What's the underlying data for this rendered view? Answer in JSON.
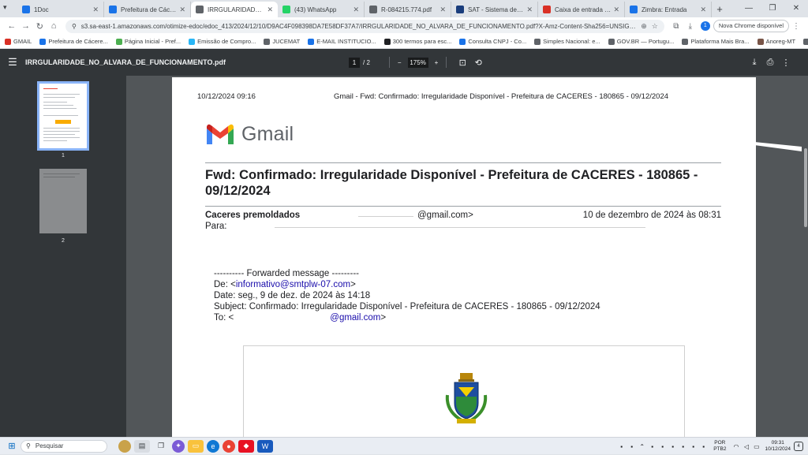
{
  "browser": {
    "tabs": [
      {
        "label": "1Doc",
        "icon": "1doc-icon",
        "color": "#1a73e8"
      },
      {
        "label": "Prefeitura de Cáceres | 1D",
        "icon": "1doc-icon",
        "color": "#1a73e8"
      },
      {
        "label": "IRRGULARIDADE_NO_ALVA",
        "icon": "globe-icon",
        "color": "#5f6368",
        "active": true
      },
      {
        "label": "(43) WhatsApp",
        "icon": "whatsapp-icon",
        "color": "#25d366"
      },
      {
        "label": "R-084215.774.pdf",
        "icon": "globe-icon",
        "color": "#5f6368"
      },
      {
        "label": "SAT - Sistema de Adminis",
        "icon": "sat-icon",
        "color": "#1a3d7c"
      },
      {
        "label": "Caixa de entrada (3) - cto",
        "icon": "gmail-icon",
        "color": "#d93025"
      },
      {
        "label": "Zimbra: Entrada",
        "icon": "zimbra-icon",
        "color": "#1a73e8"
      }
    ],
    "new_tab": "+",
    "url": "s3.sa-east-1.amazonaws.com/otimize-edoc/edoc_413/2024/12/10/D9AC4F098398DA7E58DF37A7/IRRGULARIDADE_NO_ALVARA_DE_FUNCIONAMENTO.pdf?X-Amz-Content-Sha256=UNSIGNED-PAYLOAD&X-Amz-A...",
    "update_button": "Nova Chrome disponível",
    "bookmarks": [
      {
        "label": "GMAIL",
        "color": "#d93025"
      },
      {
        "label": "Prefeitura de Cácere...",
        "color": "#1a73e8"
      },
      {
        "label": "Página Inicial - Pref...",
        "color": "#4caf50"
      },
      {
        "label": "Emissão de Compro...",
        "color": "#29b6f6"
      },
      {
        "label": "JUCEMAT",
        "color": "#5f6368"
      },
      {
        "label": "E-MAIL INSTITUCIO...",
        "color": "#1a73e8"
      },
      {
        "label": "300 termos para esc...",
        "color": "#202124"
      },
      {
        "label": "Consulta CNPJ - Co...",
        "color": "#1a73e8"
      },
      {
        "label": "Simples Nacional: e...",
        "color": "#5f6368"
      },
      {
        "label": "GOV.BR — Portugu...",
        "color": "#5f6368"
      },
      {
        "label": "Plataforma Mais Bra...",
        "color": "#5f6368"
      },
      {
        "label": "Anoreg-MT",
        "color": "#795548"
      },
      {
        "label": "CRC",
        "color": "#5f6368"
      }
    ]
  },
  "pdf_viewer": {
    "title": "IRRGULARIDADE_NO_ALVARA_DE_FUNCIONAMENTO.pdf",
    "current_page": "1",
    "page_sep": "/",
    "total_pages": "2",
    "zoom_minus": "−",
    "zoom": "175%",
    "zoom_plus": "+",
    "thumbnails": [
      {
        "num": "1"
      },
      {
        "num": "2"
      }
    ]
  },
  "document": {
    "print_date": "10/12/2024 09:16",
    "print_title": "Gmail - Fwd: Confirmado: Irregularidade Disponível - Prefeitura de CACERES - 180865 - 09/12/2024",
    "logo_text": "Gmail",
    "subject": "Fwd: Confirmado: Irregularidade Disponível - Prefeitura de CACERES - 180865 - 09/12/2024",
    "from_name": "Caceres premoldados",
    "from_addr": "@gmail.com>",
    "sent_date": "10 de dezembro de 2024 às 08:31",
    "to_label": "Para:",
    "forward": {
      "header": "---------- Forwarded message ---------",
      "de_label": "De: <",
      "de_email": "informativo@smtplw-07.com",
      "de_end": ">",
      "date": "Date: seg., 9 de dez. de 2024 às 14:18",
      "subject": "Subject: Confirmado: Irregularidade Disponível - Prefeitura de CACERES - 180865 - 09/12/2024",
      "to_label": "To: <",
      "to_email": "@gmail.com",
      "to_end": ">"
    }
  },
  "taskbar": {
    "search_placeholder": "Pesquisar",
    "lang_top": "POR",
    "lang_bottom": "PTB2",
    "time": "09:31",
    "date": "10/12/2024"
  }
}
